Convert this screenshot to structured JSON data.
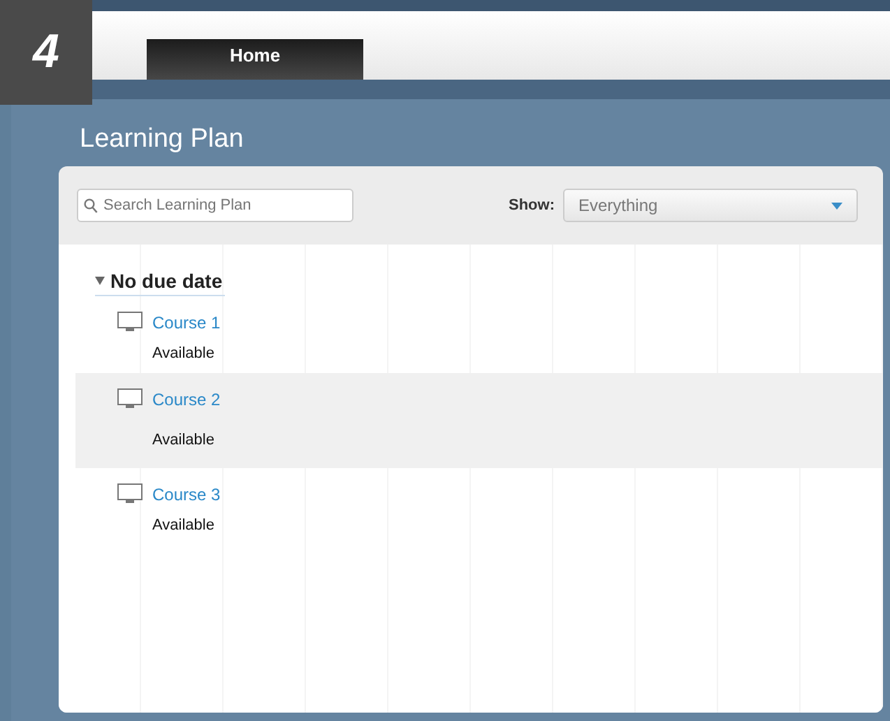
{
  "step_badge": "4",
  "tabs": [
    {
      "label": "Home",
      "selected": true
    }
  ],
  "title": "Learning Plan",
  "search": {
    "placeholder": "Search Learning Plan"
  },
  "filter": {
    "label": "Show:",
    "value": "Everything"
  },
  "group": {
    "label": "No due date",
    "expanded": true,
    "items": [
      {
        "name": "Course 1",
        "status": "Available",
        "selected": false
      },
      {
        "name": "Course 2",
        "status": "Available",
        "selected": true
      },
      {
        "name": "Course 3",
        "status": "Available",
        "selected": false
      }
    ]
  }
}
